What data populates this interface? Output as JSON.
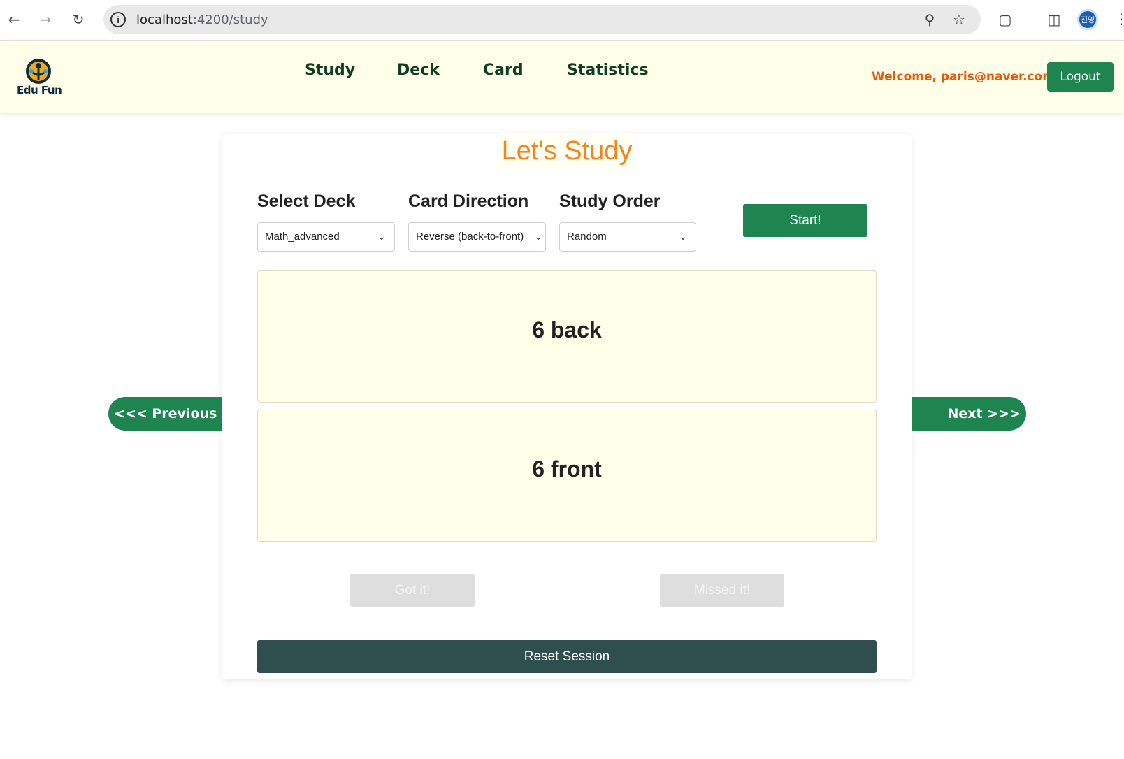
{
  "browser": {
    "url_host": "localhost",
    "url_path": ":4200/study",
    "back_icon": "arrow-left-icon",
    "forward_icon": "arrow-right-icon",
    "reload_icon": "reload-icon",
    "avatar_text": "진영"
  },
  "header": {
    "logo_text": "Edu Fun",
    "nav": [
      "Study",
      "Deck",
      "Card",
      "Statistics"
    ],
    "welcome": "Welcome,  paris@naver.com!",
    "logout_label": "Logout",
    "accent_color": "#1e8450",
    "welcome_color": "#e8590c"
  },
  "study": {
    "title": "Let's Study",
    "deck_label": "Select Deck",
    "deck_value": "Math_advanced",
    "direction_label": "Card Direction",
    "direction_value": "Reverse (back-to-front)",
    "order_label": "Study Order",
    "order_value": "Random",
    "start_label": "Start!",
    "card_top": "6 back",
    "card_bottom": "6 front",
    "prev_label": "<<< Previous",
    "next_label": "Next >>>",
    "got_label": "Got it!",
    "missed_label": "Missed it!",
    "reset_label": "Reset Session"
  }
}
